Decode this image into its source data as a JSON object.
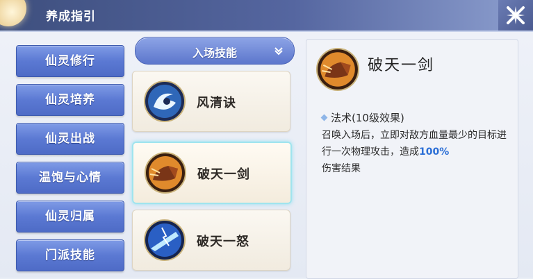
{
  "window": {
    "title": "养成指引"
  },
  "sidebar": {
    "items": [
      {
        "label": "仙灵修行"
      },
      {
        "label": "仙灵培养"
      },
      {
        "label": "仙灵出战"
      },
      {
        "label": "温饱与心情"
      },
      {
        "label": "仙灵归属"
      },
      {
        "label": "门派技能"
      }
    ]
  },
  "skills_panel": {
    "dropdown_label": "入场技能",
    "items": [
      {
        "name": "风清诀",
        "icon": "wind-swirl-icon"
      },
      {
        "name": "破天一剑",
        "icon": "fist-strike-icon"
      },
      {
        "name": "破天一怒",
        "icon": "lightning-strike-icon"
      }
    ],
    "selected": "破天一剑"
  },
  "detail": {
    "name": "破天一剑",
    "type": "法术(10级效果)",
    "desc_a": "召唤入场后，立即对敌方血量最少的目标进行一次物理攻击，造成",
    "desc_pct": "100%",
    "desc_b": "伤害结果"
  },
  "colors": {
    "accent": "#5b79d3",
    "highlight": "#2c6fd6",
    "selected_border": "#9fe4ee"
  }
}
